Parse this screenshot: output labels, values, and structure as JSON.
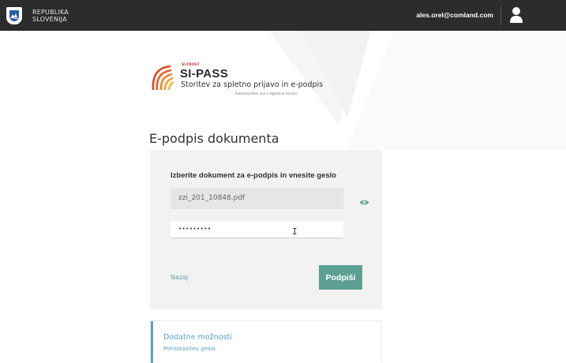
{
  "header": {
    "country_line1": "REPUBLIKA",
    "country_line2": "SLOVENIJA",
    "user_email": "ales.orel@comland.com"
  },
  "brand": {
    "tagline_top": "SI-TRUST",
    "name": "SI-PASS",
    "service": "Storitev za spletno prijavo in e-podpis",
    "service_en": "Authentication and e-Signature Service"
  },
  "page": {
    "title": "E-podpis dokumenta"
  },
  "form": {
    "heading": "Izberite dokument za e-podpis in vnesite geslo",
    "file_value": "zzi_201_10848.pdf",
    "password_value": "•••••••••",
    "back_label": "Nazaj",
    "sign_label": "Podpiši"
  },
  "options": {
    "title": "Dodatne možnosti",
    "reset_password": "Ponastavitev gesla"
  },
  "colors": {
    "topbar": "#2c2c2c",
    "accent_green": "#5c9f93",
    "link_teal": "#5aa3a6",
    "options_blue": "#5aa3c4"
  }
}
